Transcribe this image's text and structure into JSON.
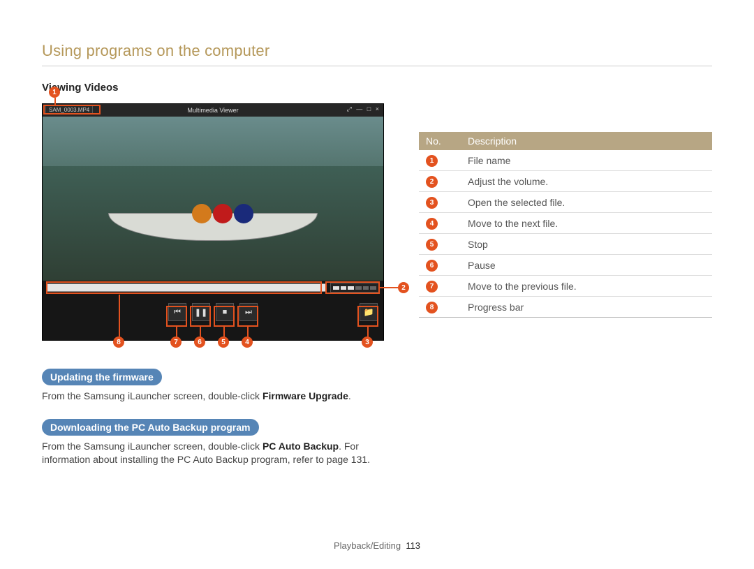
{
  "section_title": "Using programs on the computer",
  "sub_heading_videos": "Viewing Videos",
  "viewer": {
    "app_title": "Multimedia Viewer",
    "file_name": "SAM_0003.MP4",
    "window_controls": "⤢  —  □  ×"
  },
  "callouts": {
    "c1": "1",
    "c2": "2",
    "c3": "3",
    "c4": "4",
    "c5": "5",
    "c6": "6",
    "c7": "7",
    "c8": "8"
  },
  "glyphs": {
    "prev": "⏮",
    "pause": "❚❚",
    "stop": "■",
    "next": "⏭",
    "folder": "📁"
  },
  "table": {
    "header_no": "No.",
    "header_desc": "Description",
    "rows": [
      {
        "n": "1",
        "d": "File name"
      },
      {
        "n": "2",
        "d": "Adjust the volume."
      },
      {
        "n": "3",
        "d": "Open the selected file."
      },
      {
        "n": "4",
        "d": "Move to the next file."
      },
      {
        "n": "5",
        "d": "Stop"
      },
      {
        "n": "6",
        "d": "Pause"
      },
      {
        "n": "7",
        "d": "Move to the previous file."
      },
      {
        "n": "8",
        "d": "Progress bar"
      }
    ]
  },
  "pill_firmware": "Updating the firmware",
  "firmware_text_a": "From the Samsung iLauncher screen, double-click ",
  "firmware_text_b": "Firmware Upgrade",
  "firmware_text_c": ".",
  "pill_backup": "Downloading the PC Auto Backup program",
  "backup_text_a": "From the Samsung iLauncher screen, double-click ",
  "backup_text_b": "PC Auto Backup",
  "backup_text_c": ". For information about installing the PC Auto Backup program, refer to page 131.",
  "footer_section": "Playback/Editing",
  "footer_page": "113"
}
